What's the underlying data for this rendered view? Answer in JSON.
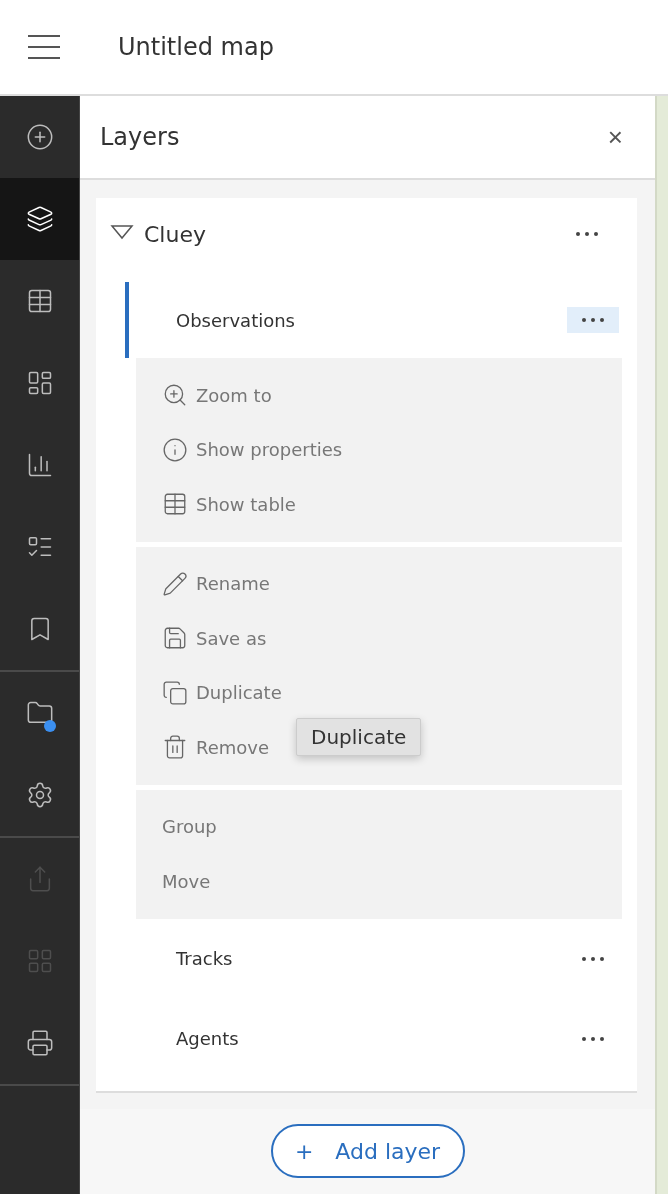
{
  "header": {
    "title": "Untitled map"
  },
  "sidebar": {
    "groups": [
      [
        {
          "kind": "add",
          "selected": false,
          "disabled": false,
          "badge": false
        },
        {
          "kind": "layers",
          "selected": true,
          "disabled": false,
          "badge": false
        },
        {
          "kind": "table",
          "selected": false,
          "disabled": false,
          "badge": false
        },
        {
          "kind": "legend",
          "selected": false,
          "disabled": false,
          "badge": false
        },
        {
          "kind": "chart",
          "selected": false,
          "disabled": false,
          "badge": false
        },
        {
          "kind": "list",
          "selected": false,
          "disabled": false,
          "badge": false
        },
        {
          "kind": "bookmark",
          "selected": false,
          "disabled": false,
          "badge": false
        }
      ],
      [
        {
          "kind": "folder",
          "selected": false,
          "disabled": false,
          "badge": true
        },
        {
          "kind": "settings",
          "selected": false,
          "disabled": false,
          "badge": false
        }
      ],
      [
        {
          "kind": "share",
          "selected": false,
          "disabled": true,
          "badge": false
        },
        {
          "kind": "apps",
          "selected": false,
          "disabled": true,
          "badge": false
        },
        {
          "kind": "print",
          "selected": false,
          "disabled": false,
          "badge": false
        }
      ]
    ]
  },
  "panel": {
    "title": "Layers",
    "close": "×",
    "group": {
      "name": "Cluey",
      "expanded": true,
      "layers": [
        {
          "name": "Observations",
          "selected": true,
          "menu_open": true
        },
        {
          "name": "Tracks",
          "selected": false,
          "menu_open": false
        },
        {
          "name": "Agents",
          "selected": false,
          "menu_open": false
        }
      ]
    },
    "menu": [
      [
        {
          "label": "Zoom to",
          "kind": "zoom"
        },
        {
          "label": "Show properties",
          "kind": "info"
        },
        {
          "label": "Show table",
          "kind": "table"
        }
      ],
      [
        {
          "label": "Rename",
          "kind": "pencil"
        },
        {
          "label": "Save as",
          "kind": "save"
        },
        {
          "label": "Duplicate",
          "kind": "copy"
        },
        {
          "label": "Remove",
          "kind": "trash"
        }
      ],
      [
        {
          "label": "Group",
          "kind": "plain"
        },
        {
          "label": "Move",
          "kind": "plain"
        }
      ]
    ],
    "tooltip": "Duplicate",
    "add_button": {
      "icon": "+",
      "label": "Add layer"
    }
  }
}
